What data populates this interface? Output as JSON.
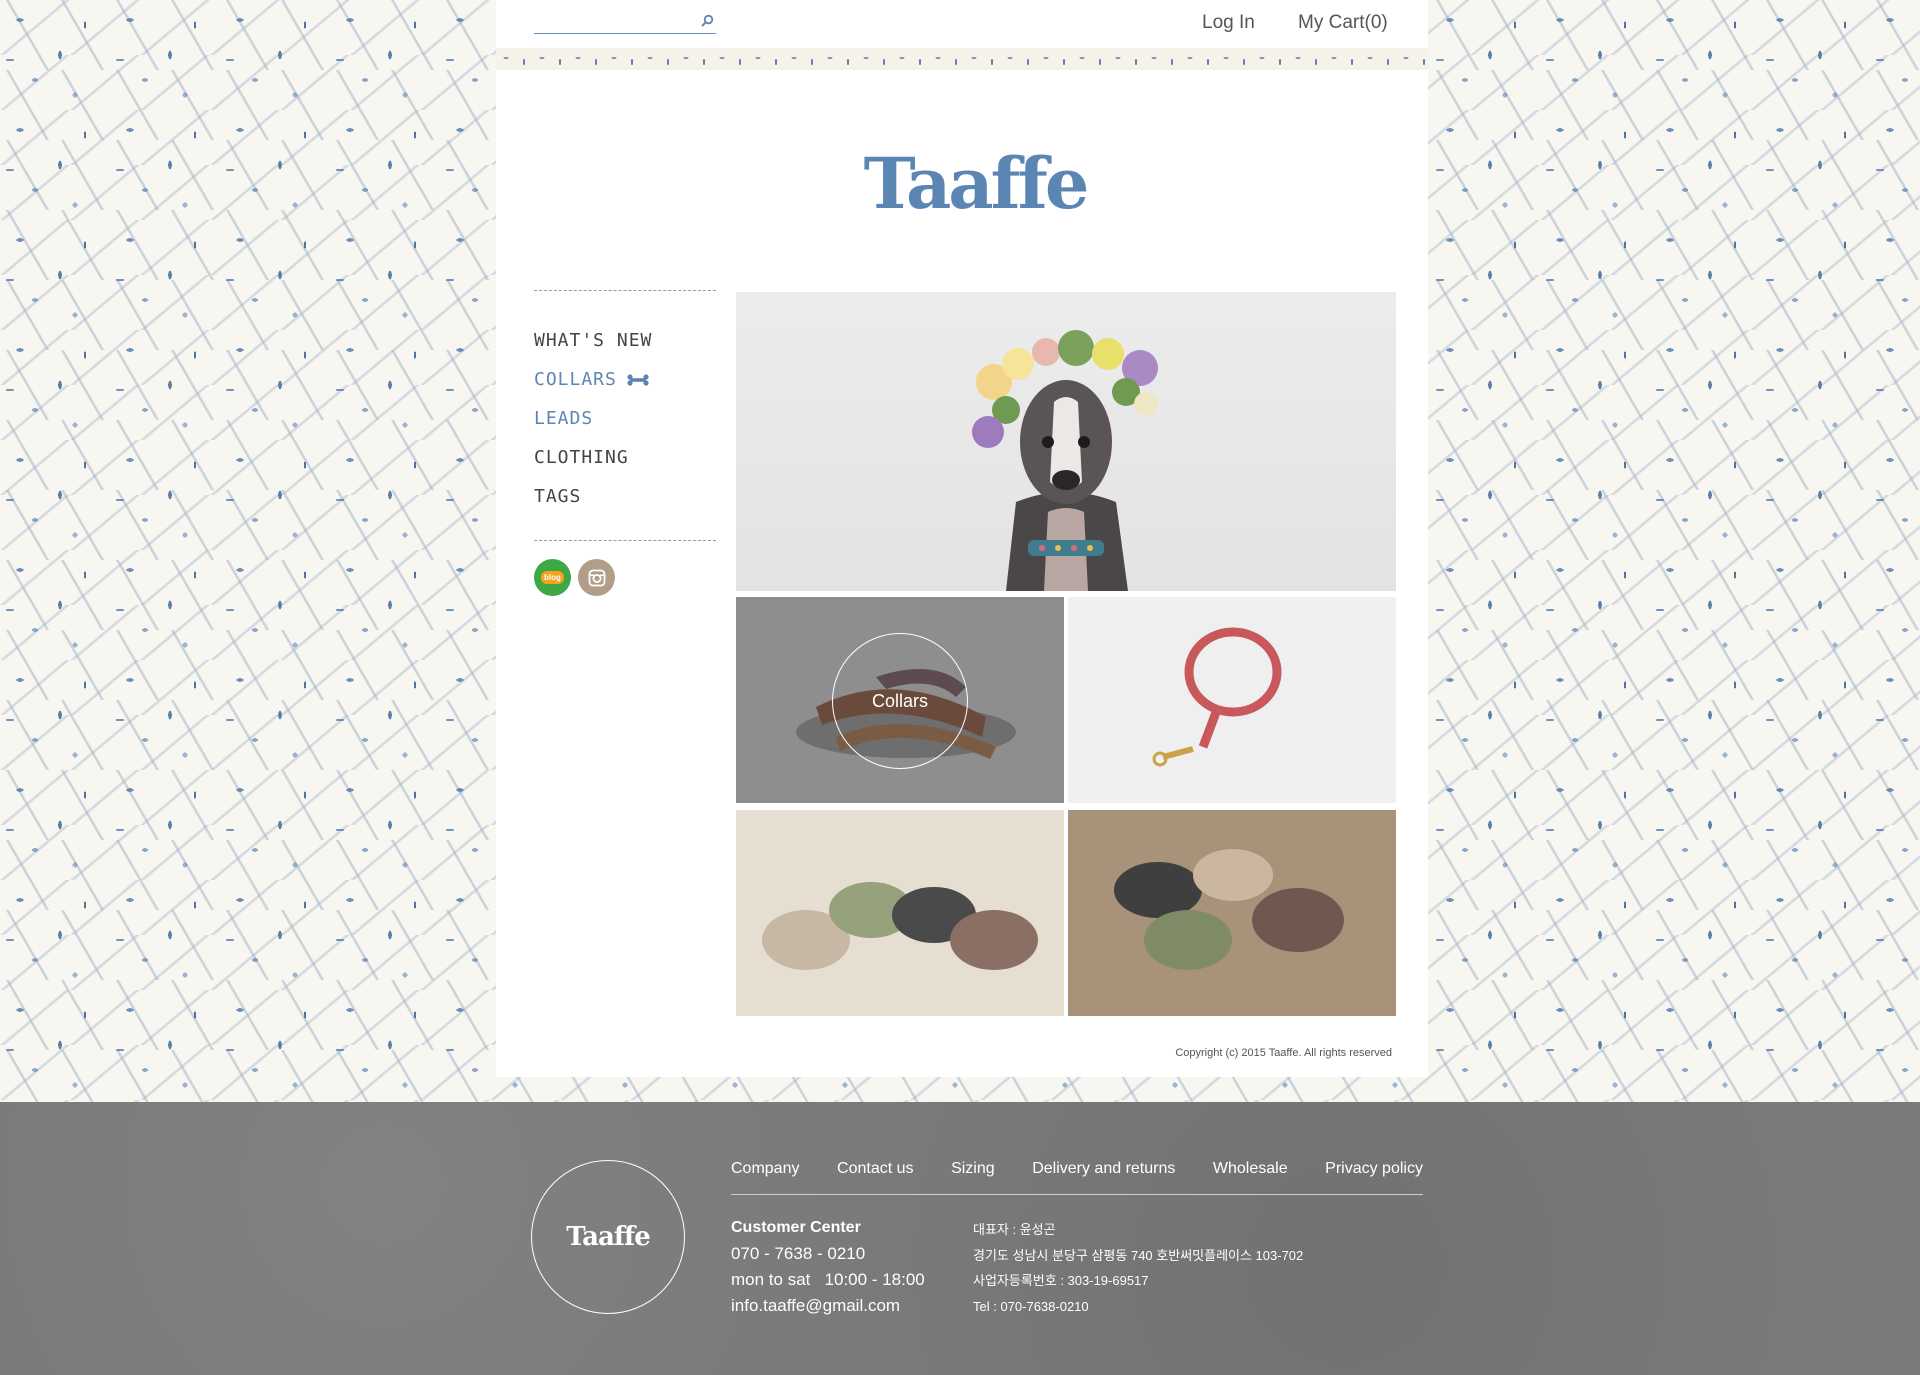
{
  "header": {
    "search_placeholder": "",
    "login": "Log In",
    "cart": "My Cart(0)"
  },
  "brand": {
    "logo": "Taaffe"
  },
  "nav": {
    "items": [
      {
        "label": "WHAT'S NEW"
      },
      {
        "label": "COLLARS"
      },
      {
        "label": "LEADS"
      },
      {
        "label": "CLOTHING"
      },
      {
        "label": "TAGS"
      }
    ]
  },
  "social": {
    "blog": "blog"
  },
  "products": {
    "overlay_label": "Collars"
  },
  "copyright": "Copyright (c) 2015 Taaffe. All rights reserved",
  "footer": {
    "badge": "Taaffe",
    "links": [
      "Company",
      "Contact us",
      "Sizing",
      "Delivery and returns",
      "Wholesale",
      "Privacy policy"
    ],
    "customer_center": {
      "title": "Customer Center",
      "phone": "070 - 7638 - 0210",
      "hours": "mon to sat   10:00 - 18:00",
      "email": "info.taaffe@gmail.com"
    },
    "corp": {
      "ceo": "대표자 : 윤성곤",
      "address": "경기도 성남시 분당구 삼평동 740 호반써밋플레이스 103-702",
      "biz_no": "사업자등록번호 : 303-19-69517",
      "tel": "Tel : 070-7638-0210"
    }
  },
  "colors": {
    "accent": "#5b86b3",
    "footer_bg": "#7a7a7a",
    "blog_green": "#3ea846",
    "insta_taupe": "#b29d88"
  }
}
